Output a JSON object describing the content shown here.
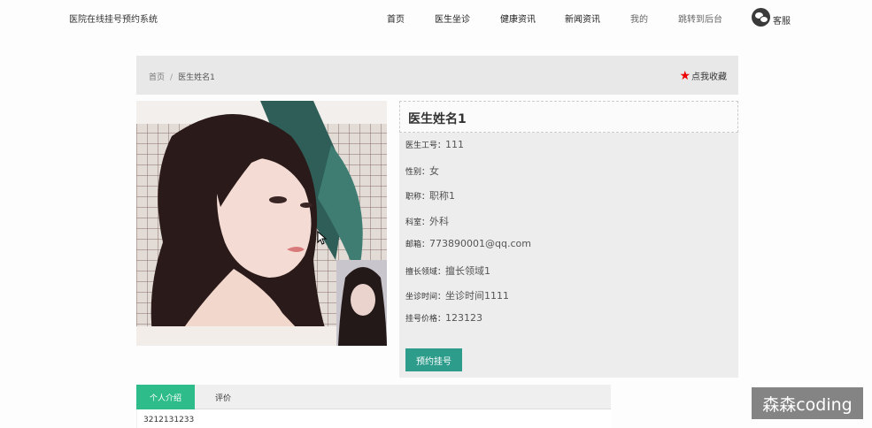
{
  "site": {
    "title": "医院在线挂号预约系统"
  },
  "nav": {
    "items": [
      {
        "label": "首页"
      },
      {
        "label": "医生坐诊"
      },
      {
        "label": "健康资讯"
      },
      {
        "label": "新闻资讯"
      },
      {
        "label": "我的"
      },
      {
        "label": "跳转到后台"
      }
    ],
    "service_label": "客服"
  },
  "breadcrumb": {
    "home": "首页",
    "separator": "/",
    "current": "医生姓名1"
  },
  "favorite": {
    "label": "点我收藏",
    "icon": "star-icon",
    "color": "#e00000"
  },
  "doctor": {
    "name": "医生姓名1",
    "fields": [
      {
        "key": "医生工号：",
        "value": "111"
      },
      {
        "key": "性别：",
        "value": "女"
      },
      {
        "key": "职称：",
        "value": "职称1"
      },
      {
        "key": "科室：",
        "value": "外科"
      },
      {
        "key": "邮箱：",
        "value": "773890001@qq.com"
      },
      {
        "key": "擅长领域：",
        "value": "擅长领域1"
      },
      {
        "key": "坐诊时间：",
        "value": "坐诊时间1111"
      },
      {
        "key": "挂号价格：",
        "value": "123123"
      }
    ],
    "book_label": "预约挂号"
  },
  "tabs": [
    {
      "label": "个人介绍",
      "active": true
    },
    {
      "label": "评价",
      "active": false
    }
  ],
  "tab_content": "3212131233",
  "watermark": "森森coding",
  "colors": {
    "accent_green": "#2ebd8a",
    "button_teal": "#2d9c8b",
    "star_red": "#e00000"
  }
}
